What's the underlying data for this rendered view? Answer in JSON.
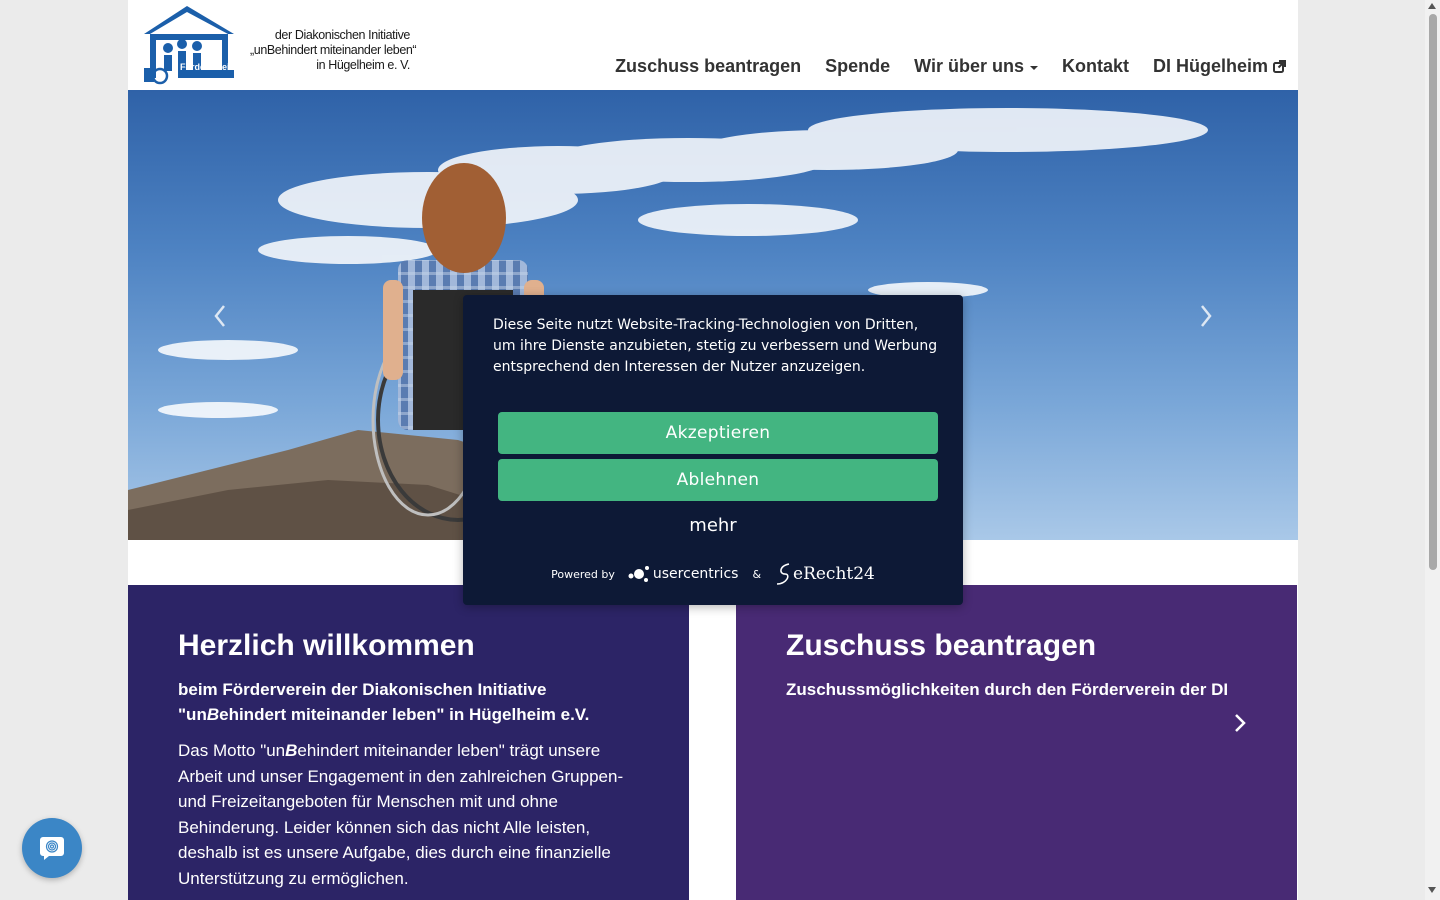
{
  "logo": {
    "badge_text": "Förderverein",
    "lines": [
      "der Diakonischen Initiative",
      "„unBehindert miteinander leben“",
      "in Hügelheim e. V."
    ]
  },
  "nav": {
    "items": [
      {
        "label": "Zuschuss beantragen"
      },
      {
        "label": "Spende"
      },
      {
        "label": "Wir über uns",
        "dropdown": true
      },
      {
        "label": "Kontakt"
      },
      {
        "label": "DI Hügelheim",
        "external": true
      }
    ]
  },
  "hero": {
    "prev_icon": "chevron-left-icon",
    "next_icon": "chevron-right-icon"
  },
  "welcome_card": {
    "title": "Herzlich willkommen",
    "subtitle_pre": "beim Förderverein der Diakonischen Initiative \"un",
    "subtitle_b": "B",
    "subtitle_post": "ehindert miteinander leben\" in Hügelheim e.V.",
    "body_pre": "Das Motto \"un",
    "body_b": "B",
    "body_post": "ehindert miteinander leben\" trägt unsere Arbeit und unser Engagement in den zahlreichen Gruppen- und Freizeitangeboten für Menschen mit und ohne Behinderung. Leider können sich das nicht Alle leisten, deshalb ist es unsere Aufgabe, dies durch eine finanzielle Unterstützung zu ermöglichen.",
    "color": "#2c2466"
  },
  "grant_card": {
    "title": "Zuschuss beantragen",
    "subtitle": "Zuschussmöglichkeiten durch den Förderverein der DI",
    "color": "#482a74"
  },
  "cookie_banner": {
    "message": "Diese Seite nutzt Website-Tracking-Technologien von Dritten, um ihre Dienste anzubieten, stetig zu verbessern und Werbung entsprechend den Interessen der Nutzer anzuzeigen.",
    "accept_label": "Akzeptieren",
    "deny_label": "Ablehnen",
    "more_label": "mehr",
    "powered_by": "Powered by",
    "brand_1": "usercentrics",
    "amp": "&",
    "brand_2": "eRecht24",
    "button_color": "#43b581",
    "background": "#0d1936"
  },
  "chat_widget": {
    "icon": "fingerprint-chat-icon",
    "color": "#3b86c6"
  }
}
